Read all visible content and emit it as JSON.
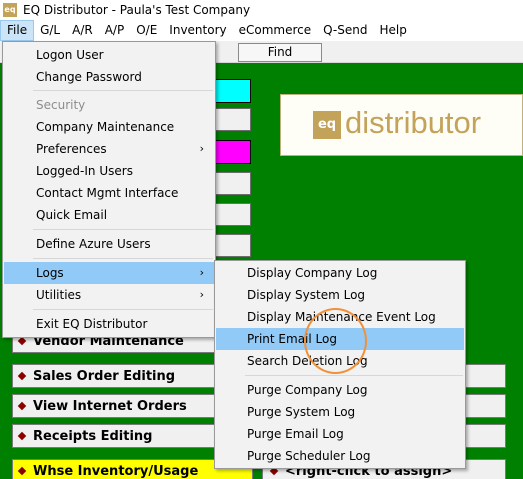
{
  "window": {
    "title": "EQ Distributor - Paula's Test Company",
    "icon_text": "eq"
  },
  "menubar": [
    "File",
    "G/L",
    "A/R",
    "A/P",
    "O/E",
    "Inventory",
    "eCommerce",
    "Q-Send",
    "Help"
  ],
  "toolbar": {
    "find_label": "Find"
  },
  "logo": {
    "mark": "eq",
    "word": "distributor"
  },
  "file_menu": {
    "logon_user": "Logon User",
    "change_password": "Change Password",
    "security_header": "Security",
    "company_maintenance": "Company Maintenance",
    "preferences": "Preferences",
    "logged_in_users": "Logged-In Users",
    "contact_mgmt_interface": "Contact Mgmt Interface",
    "quick_email": "Quick Email",
    "define_azure_users": "Define Azure Users",
    "logs": "Logs",
    "utilities": "Utilities",
    "exit": "Exit EQ Distributor",
    "submenu_arrow": "›"
  },
  "logs_menu": {
    "display_company_log": "Display Company Log",
    "display_system_log": "Display System Log",
    "display_maintenance_event_log": "Display Maintenance Event Log",
    "print_email_log": "Print Email Log",
    "search_deletion_log": "Search Deletion Log",
    "purge_company_log": "Purge Company Log",
    "purge_system_log": "Purge System Log",
    "purge_email_log": "Purge Email Log",
    "purge_scheduler_log": "Purge Scheduler Log"
  },
  "left_buttons": {
    "vendor_maintenance": "Vendor Maintenance",
    "sales_order_editing": "Sales Order Editing",
    "view_internet_orders": "View Internet Orders",
    "receipts_editing": "Receipts Editing",
    "whse_inventory_usage": "Whse Inventory/Usage"
  },
  "right_buttons": {
    "assign_hint": "<right-click to assign>"
  },
  "colors": {
    "background": "#008000",
    "highlight": "#91c9f7",
    "accent": "#c3a25a",
    "annotation": "#f0913a"
  }
}
